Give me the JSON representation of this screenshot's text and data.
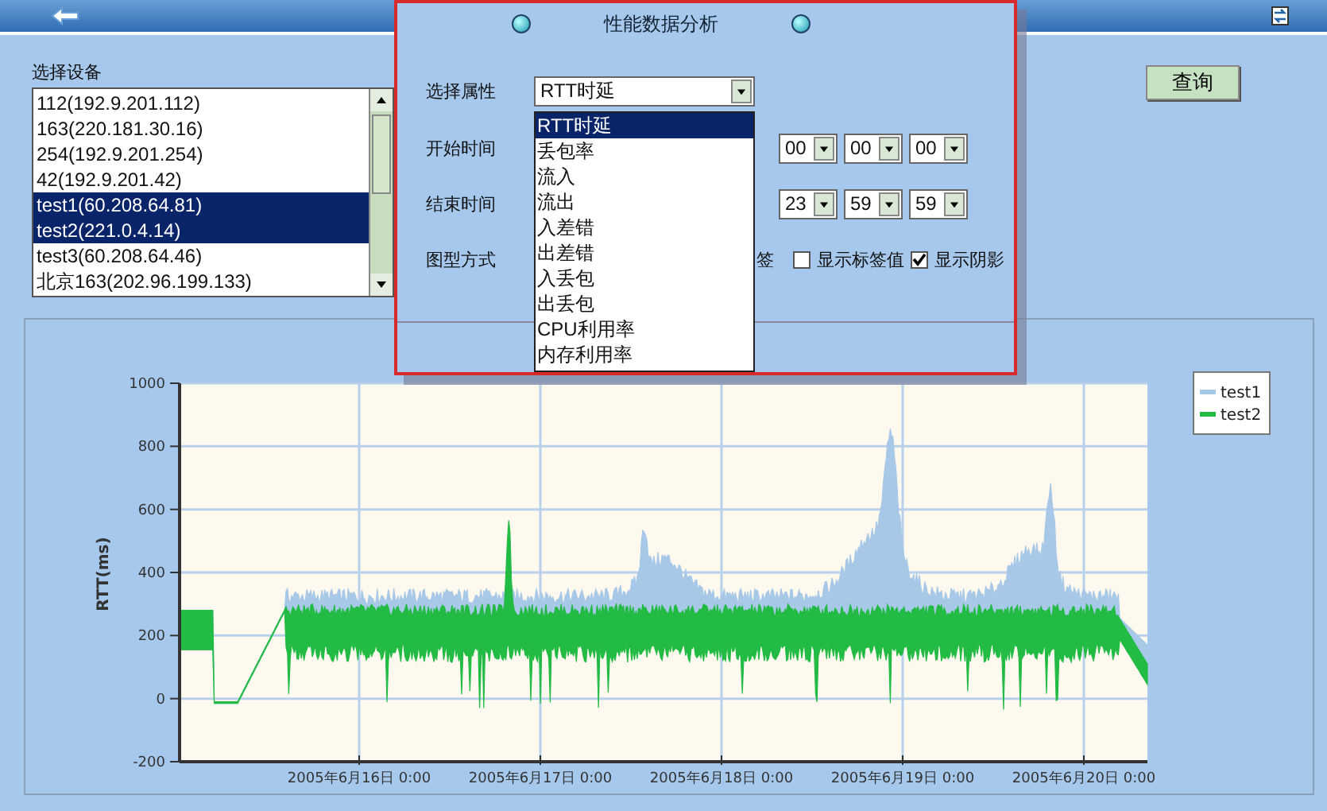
{
  "device_panel": {
    "label": "选择设备",
    "devices": [
      {
        "name": "112(192.9.201.112)",
        "selected": false
      },
      {
        "name": "163(220.181.30.16)",
        "selected": false
      },
      {
        "name": "254(192.9.201.254)",
        "selected": false
      },
      {
        "name": "42(192.9.201.42)",
        "selected": false
      },
      {
        "name": "test1(60.208.64.81)",
        "selected": true
      },
      {
        "name": "test2(221.0.4.14)",
        "selected": true
      },
      {
        "name": "test3(60.208.64.46)",
        "selected": false
      },
      {
        "name": "北京163(202.96.199.133)",
        "selected": false
      }
    ]
  },
  "query_button": "查询",
  "dialog": {
    "title": "性能数据分析",
    "attribute_label": "选择属性",
    "attribute_value": "RTT时延",
    "attribute_options": [
      {
        "label": "RTT时延",
        "selected": true
      },
      {
        "label": "丢包率",
        "selected": false
      },
      {
        "label": "流入",
        "selected": false
      },
      {
        "label": "流出",
        "selected": false
      },
      {
        "label": "入差错",
        "selected": false
      },
      {
        "label": "出差错",
        "selected": false
      },
      {
        "label": "入丢包",
        "selected": false
      },
      {
        "label": "出丢包",
        "selected": false
      },
      {
        "label": "CPU利用率",
        "selected": false
      },
      {
        "label": "内存利用率",
        "selected": false
      }
    ],
    "start_label": "开始时间",
    "start_time": [
      "00",
      "00",
      "00"
    ],
    "end_label": "结束时间",
    "end_time": [
      "23",
      "59",
      "59"
    ],
    "chart_type_label": "图型方式",
    "partial_text": "签",
    "options": [
      {
        "label": "显示标签值",
        "checked": false
      },
      {
        "label": "显示阴影",
        "checked": true
      }
    ]
  },
  "chart": {
    "ylabel": "RTT(ms)",
    "yticks": [
      "1000",
      "800",
      "600",
      "400",
      "200",
      "0",
      "-200"
    ],
    "xlabels": [
      "2005年6月16日 0:00",
      "2005年6月17日 0:00",
      "2005年6月18日 0:00",
      "2005年6月19日 0:00",
      "2005年6月20日 0:00"
    ],
    "legend": [
      {
        "name": "test1",
        "color": "#a8c8e8"
      },
      {
        "name": "test2",
        "color": "#22bb44"
      }
    ]
  }
}
